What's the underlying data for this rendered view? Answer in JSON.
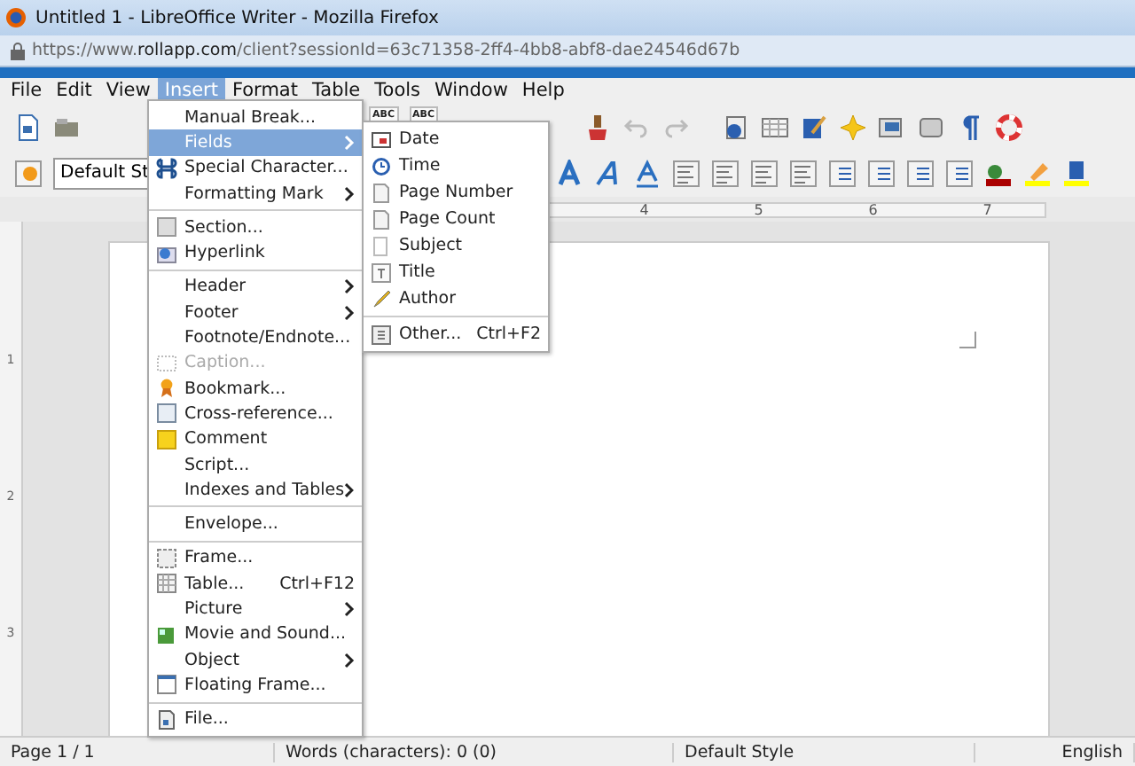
{
  "window": {
    "title": "Untitled 1 - LibreOffice Writer - Mozilla Firefox",
    "url_prefix": "https://www.",
    "url_host": "rollapp.com",
    "url_path": "/client?sessionId=63c71358-2ff4-4bb8-abf8-dae24546d67b"
  },
  "menubar": [
    {
      "label": "File",
      "selected": false
    },
    {
      "label": "Edit",
      "selected": false
    },
    {
      "label": "View",
      "selected": false
    },
    {
      "label": "Insert",
      "selected": true
    },
    {
      "label": "Format",
      "selected": false
    },
    {
      "label": "Table",
      "selected": false
    },
    {
      "label": "Tools",
      "selected": false
    },
    {
      "label": "Window",
      "selected": false
    },
    {
      "label": "Help",
      "selected": false
    }
  ],
  "toolbar": {
    "spell_labels": [
      "ABC",
      "ABC"
    ],
    "style_box": "Default St"
  },
  "ruler": {
    "marks": [
      "4",
      "5",
      "6",
      "7"
    ],
    "vertical_marks": [
      "1",
      "2",
      "3"
    ]
  },
  "insert_menu": [
    {
      "kind": "item",
      "label": "Manual Break...",
      "selected": false,
      "disabled": false,
      "submenu": false
    },
    {
      "kind": "item",
      "label": "Fields",
      "selected": true,
      "disabled": false,
      "submenu": true
    },
    {
      "kind": "item",
      "label": "Special Character...",
      "selected": false,
      "disabled": false,
      "submenu": false
    },
    {
      "kind": "item",
      "label": "Formatting Mark",
      "selected": false,
      "disabled": false,
      "submenu": true
    },
    {
      "kind": "separator"
    },
    {
      "kind": "item",
      "label": "Section...",
      "selected": false,
      "disabled": false,
      "submenu": false
    },
    {
      "kind": "item",
      "label": "Hyperlink",
      "selected": false,
      "disabled": false,
      "submenu": false
    },
    {
      "kind": "separator"
    },
    {
      "kind": "item",
      "label": "Header",
      "selected": false,
      "disabled": false,
      "submenu": true
    },
    {
      "kind": "item",
      "label": "Footer",
      "selected": false,
      "disabled": false,
      "submenu": true
    },
    {
      "kind": "item",
      "label": "Footnote/Endnote...",
      "selected": false,
      "disabled": false,
      "submenu": false
    },
    {
      "kind": "item",
      "label": "Caption...",
      "selected": false,
      "disabled": true,
      "submenu": false
    },
    {
      "kind": "item",
      "label": "Bookmark...",
      "selected": false,
      "disabled": false,
      "submenu": false
    },
    {
      "kind": "item",
      "label": "Cross-reference...",
      "selected": false,
      "disabled": false,
      "submenu": false
    },
    {
      "kind": "item",
      "label": "Comment",
      "selected": false,
      "disabled": false,
      "submenu": false
    },
    {
      "kind": "item",
      "label": "Script...",
      "selected": false,
      "disabled": false,
      "submenu": false
    },
    {
      "kind": "item",
      "label": "Indexes and Tables",
      "selected": false,
      "disabled": false,
      "submenu": true
    },
    {
      "kind": "separator"
    },
    {
      "kind": "item",
      "label": "Envelope...",
      "selected": false,
      "disabled": false,
      "submenu": false
    },
    {
      "kind": "separator"
    },
    {
      "kind": "item",
      "label": "Frame...",
      "selected": false,
      "disabled": false,
      "submenu": false
    },
    {
      "kind": "item",
      "label": "Table...",
      "shortcut": "Ctrl+F12",
      "selected": false,
      "disabled": false,
      "submenu": false
    },
    {
      "kind": "item",
      "label": "Picture",
      "selected": false,
      "disabled": false,
      "submenu": true
    },
    {
      "kind": "item",
      "label": "Movie and Sound...",
      "selected": false,
      "disabled": false,
      "submenu": false
    },
    {
      "kind": "item",
      "label": "Object",
      "selected": false,
      "disabled": false,
      "submenu": true
    },
    {
      "kind": "item",
      "label": "Floating Frame...",
      "selected": false,
      "disabled": false,
      "submenu": false
    },
    {
      "kind": "separator"
    },
    {
      "kind": "item",
      "label": "File...",
      "selected": false,
      "disabled": false,
      "submenu": false
    }
  ],
  "fields_menu": [
    {
      "kind": "item",
      "label": "Date"
    },
    {
      "kind": "item",
      "label": "Time"
    },
    {
      "kind": "item",
      "label": "Page Number"
    },
    {
      "kind": "item",
      "label": "Page Count"
    },
    {
      "kind": "item",
      "label": "Subject"
    },
    {
      "kind": "item",
      "label": "Title"
    },
    {
      "kind": "item",
      "label": "Author"
    },
    {
      "kind": "separator"
    },
    {
      "kind": "item",
      "label": "Other...",
      "shortcut": "Ctrl+F2"
    }
  ],
  "status_bar": [
    "Page 1 / 1",
    "Words (characters): 0 (0)",
    "Default Style",
    "English"
  ]
}
